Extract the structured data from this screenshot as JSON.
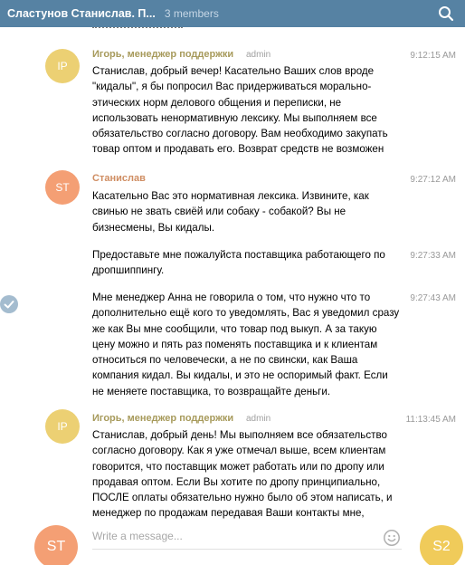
{
  "header": {
    "title": "Сластунов Станислав. П...",
    "members": "3 members"
  },
  "messages": [
    {
      "author": "Игорь, менеджер поддержки",
      "role": "admin",
      "initials": "IP",
      "time": "9:12:15 AM",
      "lines": [
        "Станислав, добрый вечер! Касательно Ваших слов вроде",
        "\"кидалы\", я бы попросил Вас придерживаться морально-",
        "этических норм делового общения и переписки, не",
        "использовать ненормативную лексику. Мы выполняем все",
        "обязательство согласно договору. Вам необходимо закупать",
        "товар оптом и продавать его. Возврат средств не возможен"
      ]
    },
    {
      "author": "Станислав",
      "initials": "ST",
      "time": "9:27:12 AM",
      "lines": [
        "Касательно Вас это нормативная лексика. Извините, как",
        "свинью не звать свиёй или собаку - собакой? Вы не",
        "бизнесмены, Вы кидалы."
      ]
    },
    {
      "time": "9:27:33 AM",
      "lines": [
        "Предоставьте мне пожалуйста поставщика работающего по",
        "дропшиппингу."
      ]
    },
    {
      "time": "9:27:43 AM",
      "lines": [
        "Мне менеджер Анна не говорила о том, что нужно что то",
        "дополнительно ещё кого то уведомлять, Вас я уведомил сразу",
        "же как Вы мне сообщили, что товар под выкуп. А за такую",
        "цену можно и пять раз поменять поставщика и к клиентам",
        "относиться по человечески, а не по свински, как Ваша",
        "компания кидал. Вы кидалы, и это не оспоримый факт. Если",
        "не меняете поставщика, то возвращайте деньги."
      ]
    },
    {
      "author": "Игорь, менеджер поддержки",
      "role": "admin",
      "initials": "IP",
      "time": "11:13:45 AM",
      "lines": [
        "Станислав, добрый день! Мы выполняем все обязательство",
        "согласно договору.  Как я уже отмечал выше, всем клиентам",
        "говорится, что поставщик может работать или по дропу или",
        "продавая оптом. Если Вы хотите по дропу принципиально,",
        "ПОСЛЕ оплаты обязательно нужно было об этом написать, и",
        "менеджер по продажам передавая Ваши контакты мне,"
      ]
    }
  ],
  "composer": {
    "placeholder": "Write a message...",
    "my_initials": "ST",
    "peer_initials": "S2"
  },
  "colors": {
    "header": "#5682a3",
    "support_name": "#a79a5b",
    "client_name": "#cf8d62",
    "avatar_ip": "#ecd073",
    "avatar_st": "#f49f74"
  }
}
